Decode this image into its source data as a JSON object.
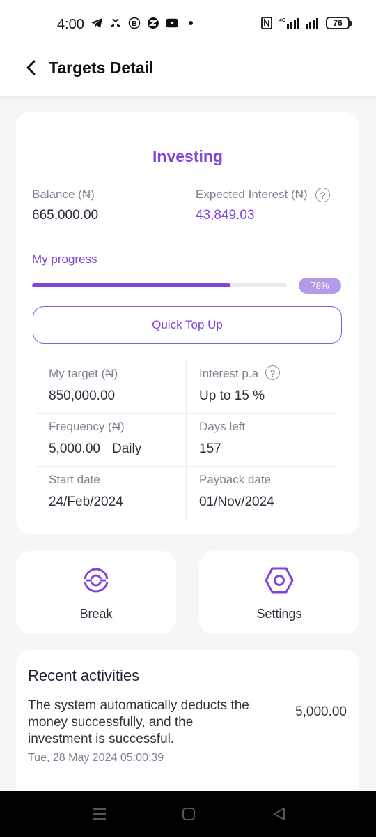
{
  "status_bar": {
    "time": "4:00",
    "battery": "76",
    "network": "4G"
  },
  "header": {
    "title": "Targets Detail"
  },
  "target": {
    "name": "Investing",
    "balance_label": "Balance (₦)",
    "balance_value": "665,000.00",
    "interest_label": "Expected Interest (₦)",
    "interest_value": "43,849.03",
    "progress_label": "My progress",
    "progress_percent": 78,
    "progress_text": "78%",
    "quick_top_up": "Quick Top Up"
  },
  "details": {
    "my_target_label": "My target (₦)",
    "my_target_value": "850,000.00",
    "interest_pa_label": "Interest p.a",
    "interest_pa_value": "Up to 15 %",
    "frequency_label": "Frequency (₦)",
    "frequency_amount": "5,000.00",
    "frequency_period": "Daily",
    "days_left_label": "Days left",
    "days_left_value": "157",
    "start_date_label": "Start date",
    "start_date_value": "24/Feb/2024",
    "payback_date_label": "Payback date",
    "payback_date_value": "01/Nov/2024"
  },
  "actions": {
    "break_label": "Break",
    "settings_label": "Settings"
  },
  "activities": {
    "title": "Recent activities",
    "items": [
      {
        "description": "The system automatically deducts the money successfully, and the investment is successful.",
        "amount": "5,000.00",
        "time": "Tue, 28 May 2024 05:00:39"
      }
    ]
  },
  "colors": {
    "accent": "#8146d8",
    "badge": "#b59ae8",
    "background": "#f5f6f8"
  },
  "icons": {
    "back": "chevron-left-icon",
    "help": "question-circle-icon",
    "break": "target-break-icon",
    "settings": "hexagon-gear-icon"
  }
}
